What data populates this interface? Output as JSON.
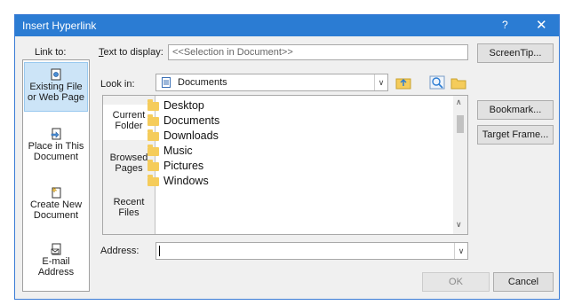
{
  "window": {
    "title": "Insert Hyperlink",
    "help": "?",
    "close": "✕"
  },
  "link_to_label": "Link to:",
  "sidebar": {
    "items": [
      {
        "label_line1": "Existing File",
        "label_line2": "or Web Page",
        "icon": "existing-file-icon",
        "selected": true
      },
      {
        "label_line1": "Place in This",
        "label_line2": "Document",
        "icon": "place-in-document-icon"
      },
      {
        "label_line1": "Create New",
        "label_line2": "Document",
        "icon": "create-new-document-icon"
      },
      {
        "label_line1": "E-mail",
        "label_line2": "Address",
        "icon": "email-icon"
      }
    ]
  },
  "text_to_display": {
    "label": "Text to display:",
    "value": "<<Selection in Document>>"
  },
  "look_in": {
    "label": "Look in:",
    "value": "Documents"
  },
  "tabs": [
    {
      "line1": "Current",
      "line2": "Folder",
      "selected": true
    },
    {
      "line1": "Browsed",
      "line2": "Pages"
    },
    {
      "line1": "Recent",
      "line2": "Files"
    }
  ],
  "files": [
    "Desktop",
    "Documents",
    "Downloads",
    "Music",
    "Pictures",
    "Windows"
  ],
  "address": {
    "label": "Address:",
    "value": ""
  },
  "buttons": {
    "screentip": "ScreenTip...",
    "bookmark": "Bookmark...",
    "target_frame": "Target Frame...",
    "ok": "OK",
    "cancel": "Cancel"
  },
  "colors": {
    "titlebar": "#2b7cd3",
    "selected": "#cce4f7",
    "folder": "#f5cc5b"
  }
}
